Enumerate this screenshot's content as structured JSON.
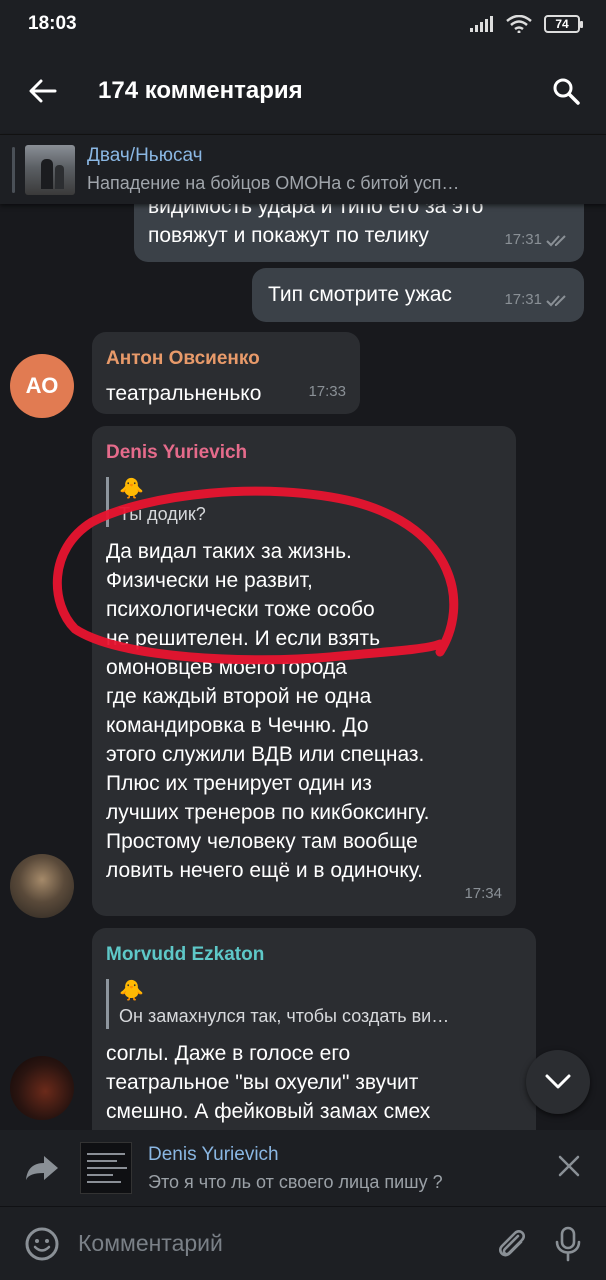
{
  "status": {
    "time": "18:03",
    "battery": "74"
  },
  "header": {
    "title": "174 комментария"
  },
  "pinned": {
    "channel": "Двач/Ньюсач",
    "message": "Нападение на бойцов ОМОНа с битой усп…"
  },
  "messages": [
    {
      "id": "out1",
      "text_line1": "видимость удара и типо его за это",
      "text_line2": "повяжут и покажут по телику",
      "time": "17:31"
    },
    {
      "id": "out2",
      "text": "Тип смотрите ужас",
      "time": "17:31"
    },
    {
      "id": "anton",
      "sender": "Антон Овсиенко",
      "sender_color": "#e89a6a",
      "avatar_initials": "АО",
      "avatar_color": "#e17b52",
      "text": "театральненько",
      "time": "17:33"
    },
    {
      "id": "denis",
      "sender": "Denis Yurievich",
      "sender_color": "#e56b8b",
      "reply_emoji": "🐥",
      "reply_text": "Ты додик?",
      "lines": [
        "Да видал таких за жизнь.",
        "Физически не развит,",
        "психологически тоже особо",
        "не решителен. И если взять",
        "омоновцев моего города",
        "где каждый второй не одна",
        "командировка в Чечню. До",
        "этого служили ВДВ или спецназ.",
        "Плюс их тренирует один из",
        "лучших тренеров по кикбоксингу.",
        "Простому человеку там вообще",
        "ловить нечего ещё и в одиночку."
      ],
      "time": "17:34"
    },
    {
      "id": "morvudd",
      "sender": "Morvudd Ezkaton",
      "sender_color": "#5ec8c8",
      "reply_emoji": "🐥",
      "reply_text": "Он замахнулся так, чтобы создать ви…",
      "lines": [
        "соглы. Даже в голосе его",
        "театральное \"вы охуели\" звучит",
        "смешно. А фейковый замах смех"
      ]
    }
  ],
  "reply_bar": {
    "name": "Denis Yurievich",
    "message": "Это я что ль от своего лица пишу ?"
  },
  "input": {
    "placeholder": "Комментарий"
  },
  "colors": {
    "accent": "#8ab7e3",
    "bubble_in": "#2b2d31",
    "bubble_out": "#3b4148",
    "annotation": "#e8142f"
  }
}
